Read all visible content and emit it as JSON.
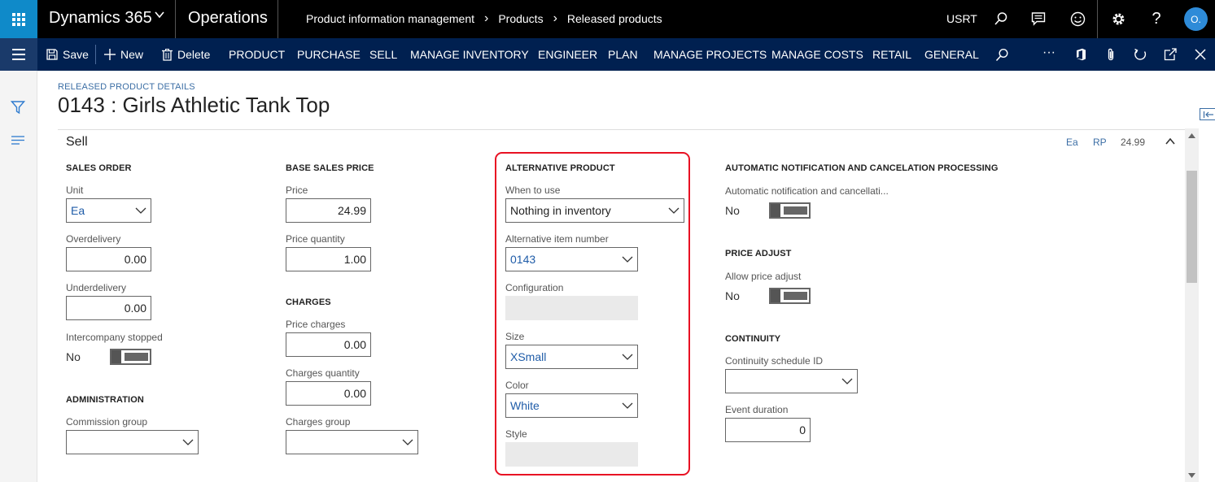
{
  "topbar": {
    "brand": "Dynamics 365",
    "app": "Operations",
    "breadcrumbs": [
      "Product information management",
      "Products",
      "Released products"
    ],
    "company": "USRT",
    "avatar": "O."
  },
  "actions": {
    "save": "Save",
    "new": "New",
    "delete": "Delete",
    "tabs": [
      "PRODUCT",
      "PURCHASE",
      "SELL",
      "MANAGE INVENTORY",
      "ENGINEER",
      "PLAN",
      "MANAGE PROJECTS",
      "MANAGE COSTS",
      "RETAIL",
      "GENERAL"
    ],
    "more": "···"
  },
  "header": {
    "caption": "RELEASED PRODUCT DETAILS",
    "title": "0143 : Girls Athletic Tank Top"
  },
  "fasttab": {
    "title": "Sell",
    "summary": [
      "Ea",
      "RP",
      "24.99"
    ]
  },
  "sales_order": {
    "heading": "SALES ORDER",
    "unit_label": "Unit",
    "unit_value": "Ea",
    "overdelivery_label": "Overdelivery",
    "overdelivery_value": "0.00",
    "underdelivery_label": "Underdelivery",
    "underdelivery_value": "0.00",
    "intercompany_label": "Intercompany stopped",
    "intercompany_value": "No"
  },
  "administration": {
    "heading": "ADMINISTRATION",
    "commission_label": "Commission group",
    "commission_value": ""
  },
  "base_sales_price": {
    "heading": "BASE SALES PRICE",
    "price_label": "Price",
    "price_value": "24.99",
    "price_qty_label": "Price quantity",
    "price_qty_value": "1.00"
  },
  "charges": {
    "heading": "CHARGES",
    "price_charges_label": "Price charges",
    "price_charges_value": "0.00",
    "charges_qty_label": "Charges quantity",
    "charges_qty_value": "0.00",
    "charges_group_label": "Charges group",
    "charges_group_value": ""
  },
  "alternative_product": {
    "heading": "ALTERNATIVE PRODUCT",
    "when_label": "When to use",
    "when_value": "Nothing in inventory",
    "item_label": "Alternative item number",
    "item_value": "0143",
    "config_label": "Configuration",
    "config_value": "",
    "size_label": "Size",
    "size_value": "XSmall",
    "color_label": "Color",
    "color_value": "White",
    "style_label": "Style",
    "style_value": ""
  },
  "auto_notification": {
    "heading": "AUTOMATIC NOTIFICATION AND CANCELATION PROCESSING",
    "label": "Automatic notification and cancellati...",
    "value": "No"
  },
  "price_adjust": {
    "heading": "PRICE ADJUST",
    "label": "Allow price adjust",
    "value": "No"
  },
  "continuity": {
    "heading": "CONTINUITY",
    "schedule_label": "Continuity schedule ID",
    "schedule_value": "",
    "duration_label": "Event duration",
    "duration_value": "0"
  },
  "colors": {
    "topbar": "#000000",
    "actionbar": "#002050",
    "waffle": "#0f8ac9",
    "highlight": "#e81123",
    "link": "#1f5ca8"
  }
}
